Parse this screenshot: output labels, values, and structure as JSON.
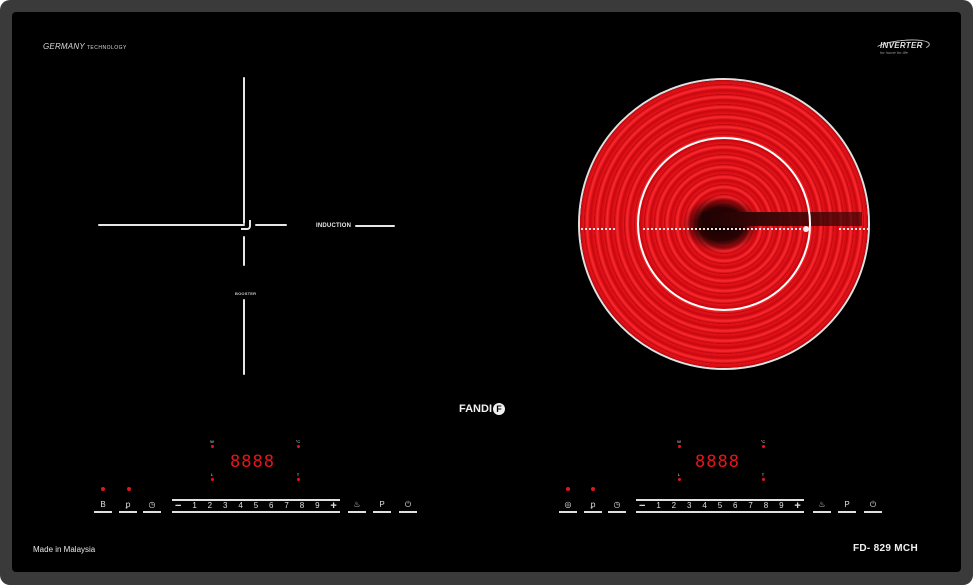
{
  "branding": {
    "germany": "GERMANY",
    "technology": "TECHNOLOGY",
    "inverter": "INVERTER",
    "inverter_tagline": "for home for life",
    "fandi": "FANDI",
    "fandi_logo_letter": "F",
    "made_in": "Made in Malaysia",
    "model": "FD- 829 MCH"
  },
  "left_zone": {
    "label": "INDUCTION",
    "booster_label": "BOOSTER"
  },
  "right_zone": {
    "colors": {
      "heat": "#e8141c",
      "ring": "#ffffff"
    }
  },
  "left_panel": {
    "display": "8888",
    "ind_w": "W",
    "ind_c": "°C",
    "ind_l": "L",
    "ind_t": "T",
    "keys": {
      "booster": "B",
      "lock": "ꝑ",
      "timer": "◷",
      "heat": "♨",
      "pause": "P",
      "power": "⏻"
    },
    "slider": {
      "minus": "−",
      "plus": "+",
      "levels": [
        "1",
        "2",
        "3",
        "4",
        "5",
        "6",
        "7",
        "8",
        "9"
      ]
    }
  },
  "right_panel": {
    "display": "8888",
    "ind_w": "W",
    "ind_c": "°C",
    "ind_l": "L",
    "ind_t": "T",
    "keys": {
      "mode": "◎",
      "lock": "ꝑ",
      "timer": "◷",
      "heat": "♨",
      "pause": "P",
      "power": "⏻"
    },
    "slider": {
      "minus": "−",
      "plus": "+",
      "levels": [
        "1",
        "2",
        "3",
        "4",
        "5",
        "6",
        "7",
        "8",
        "9"
      ]
    }
  },
  "colors": {
    "display_red": "#e8141a",
    "glass": "#000000",
    "frame": "#3a3a3a"
  }
}
